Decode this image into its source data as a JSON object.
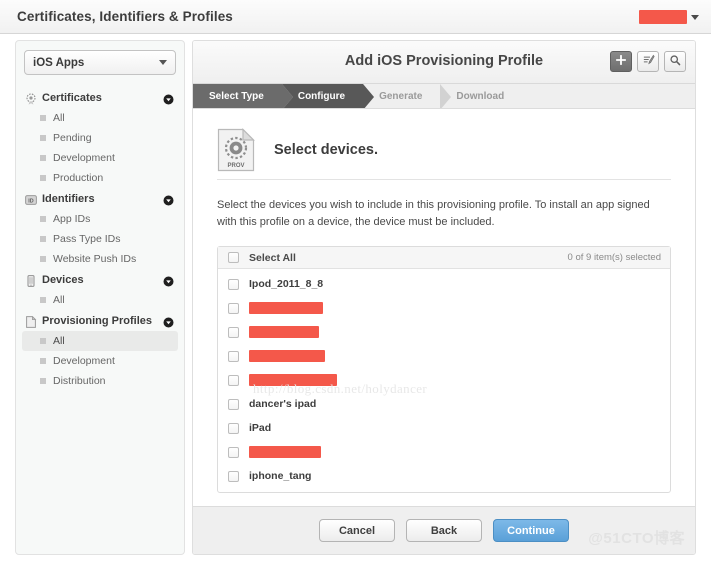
{
  "window": {
    "title": "Certificates, Identifiers & Profiles",
    "account_redacted": true,
    "account_caret_icon": "chevron-down-icon"
  },
  "sidebar": {
    "platform_select": {
      "value": "iOS Apps",
      "caret_icon": "chevron-down-icon"
    },
    "groups": [
      {
        "label": "Certificates",
        "icon": "certificate-icon",
        "chevron_icon": "chevron-down-circle-icon",
        "items": [
          {
            "label": "All",
            "selected": false
          },
          {
            "label": "Pending",
            "selected": false
          },
          {
            "label": "Development",
            "selected": false
          },
          {
            "label": "Production",
            "selected": false
          }
        ]
      },
      {
        "label": "Identifiers",
        "icon": "identifier-badge-icon",
        "chevron_icon": "chevron-down-circle-icon",
        "items": [
          {
            "label": "App IDs",
            "selected": false
          },
          {
            "label": "Pass Type IDs",
            "selected": false
          },
          {
            "label": "Website Push IDs",
            "selected": false
          }
        ]
      },
      {
        "label": "Devices",
        "icon": "device-phone-icon",
        "chevron_icon": "chevron-down-circle-icon",
        "items": [
          {
            "label": "All",
            "selected": false
          }
        ]
      },
      {
        "label": "Provisioning Profiles",
        "icon": "profile-document-icon",
        "chevron_icon": "chevron-down-circle-icon",
        "items": [
          {
            "label": "All",
            "selected": true
          },
          {
            "label": "Development",
            "selected": false
          },
          {
            "label": "Distribution",
            "selected": false
          }
        ]
      }
    ]
  },
  "main": {
    "title": "Add iOS Provisioning Profile",
    "toolbar": [
      {
        "name": "add-button",
        "icon": "plus-icon",
        "active": true
      },
      {
        "name": "edit-button",
        "icon": "edit-pencil-icon",
        "active": false
      },
      {
        "name": "search-button",
        "icon": "search-icon",
        "active": false
      }
    ],
    "steps": [
      {
        "label": "Select Type",
        "state": "done"
      },
      {
        "label": "Configure",
        "state": "active"
      },
      {
        "label": "Generate",
        "state": "todo"
      },
      {
        "label": "Download",
        "state": "todo"
      }
    ],
    "section": {
      "icon": "prov-profile-document-icon",
      "icon_label": "PROV",
      "title": "Select devices.",
      "description": "Select the devices you wish to include in this provisioning profile. To install an app signed with this profile on a device, the device must be included."
    },
    "device_list": {
      "select_all_label": "Select All",
      "select_all_checked": false,
      "selection_status": "0 of 9 item(s) selected",
      "rows": [
        {
          "label": "Ipod_2011_8_8",
          "checked": false,
          "redacted": false,
          "redact_width": 0
        },
        {
          "label": "",
          "checked": false,
          "redacted": true,
          "redact_width": 74
        },
        {
          "label": "",
          "checked": false,
          "redacted": true,
          "redact_width": 70
        },
        {
          "label": "",
          "checked": false,
          "redacted": true,
          "redact_width": 76
        },
        {
          "label": "",
          "checked": false,
          "redacted": true,
          "redact_width": 88
        },
        {
          "label": "dancer's ipad",
          "checked": false,
          "redacted": false,
          "redact_width": 0
        },
        {
          "label": "iPad",
          "checked": false,
          "redacted": false,
          "redact_width": 0
        },
        {
          "label": "",
          "checked": false,
          "redacted": true,
          "redact_width": 72
        },
        {
          "label": "iphone_tang",
          "checked": false,
          "redacted": false,
          "redact_width": 0
        }
      ]
    },
    "footer": {
      "cancel_label": "Cancel",
      "back_label": "Back",
      "continue_label": "Continue"
    }
  },
  "watermarks": {
    "url": "http://blog.csdn.net/holydancer",
    "site": "@51CTO博客"
  },
  "colors": {
    "redaction": "#f4584a",
    "primary_button": "#5aa0d8",
    "step_active": "#585858",
    "step_done": "#6b6b6b"
  }
}
